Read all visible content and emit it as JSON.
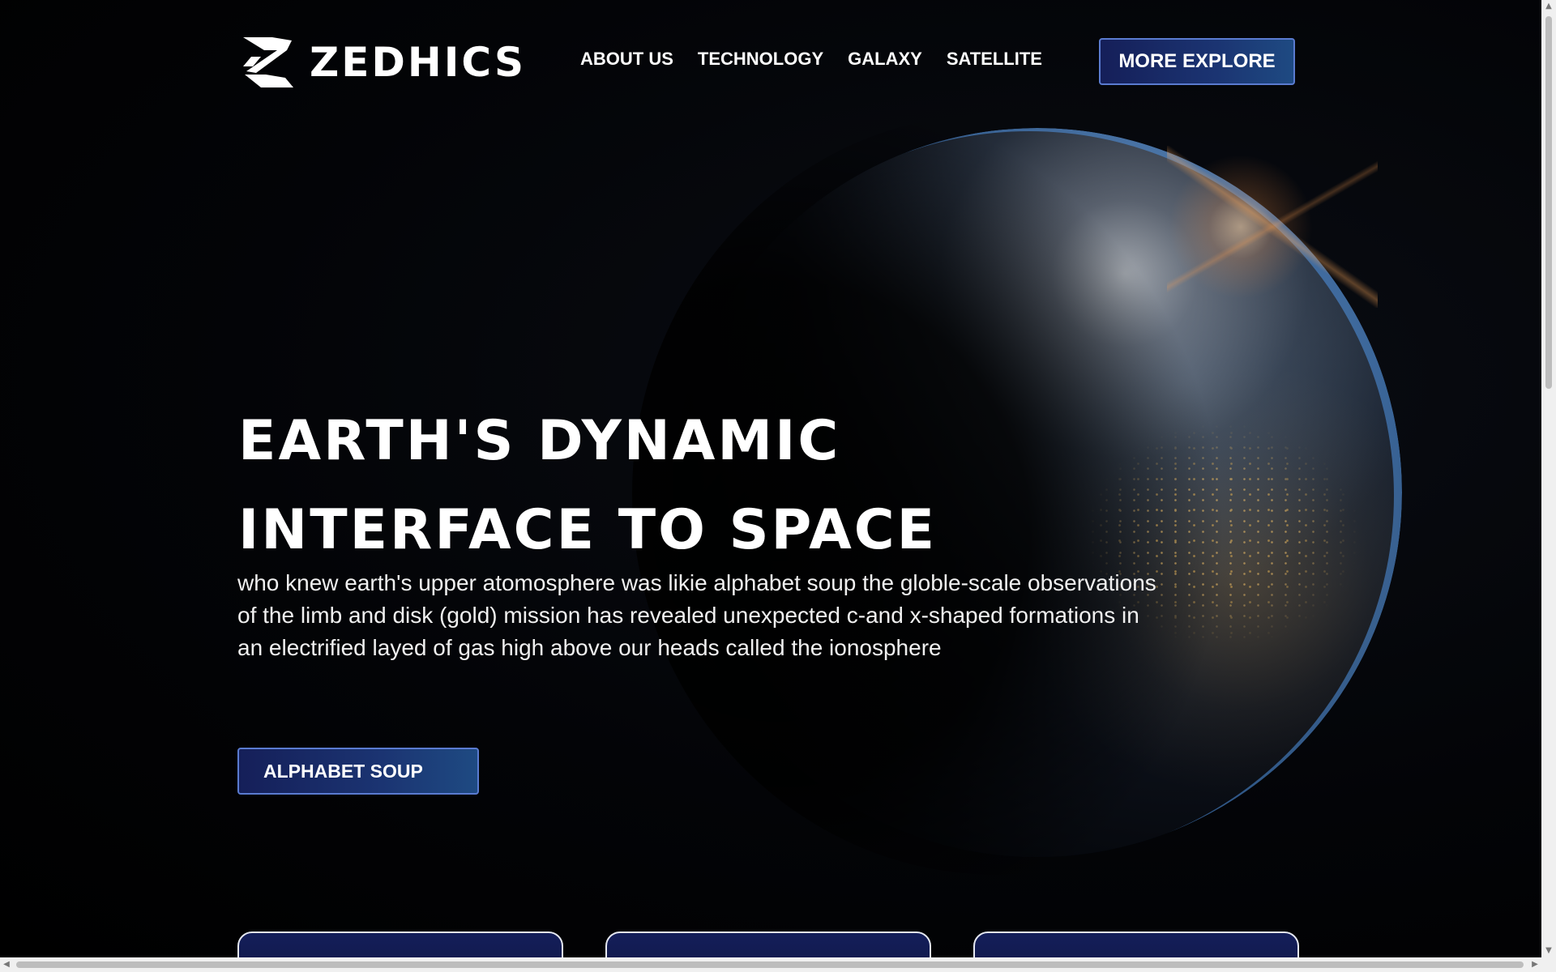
{
  "brand": {
    "name": "ZEDHICS",
    "logo_icon": "zedhics-logo-mark"
  },
  "nav": {
    "items": [
      {
        "label": "ABOUT US"
      },
      {
        "label": "TECHNOLOGY"
      },
      {
        "label": "GALAXY"
      },
      {
        "label": "SATELLITE"
      }
    ],
    "cta_label": "MORE EXPLORE"
  },
  "hero": {
    "title_line1": "EARTH'S DYNAMIC",
    "title_line2": "INTERFACE TO SPACE",
    "description": "who knew earth's upper atomosphere was likie alphabet soup the globle-scale observations of the limb and disk (gold) mission has revealed unexpected c-and x-shaped formations in an electrified layed of gas high above our heads called the ionosphere",
    "button_label": "ALPHABET SOUP"
  },
  "colors": {
    "background": "#000000",
    "button_gradient_start": "#151f59",
    "button_gradient_end": "#1e4a82",
    "button_border": "#5a7bd0",
    "card_fill": "#141e5a",
    "atmosphere_glow": "#5096e6",
    "city_lights": "#f5c46a"
  },
  "icons": {
    "scroll_up": "chevron-up-icon",
    "scroll_down": "chevron-down-icon",
    "scroll_left": "chevron-left-icon",
    "scroll_right": "chevron-right-icon"
  }
}
